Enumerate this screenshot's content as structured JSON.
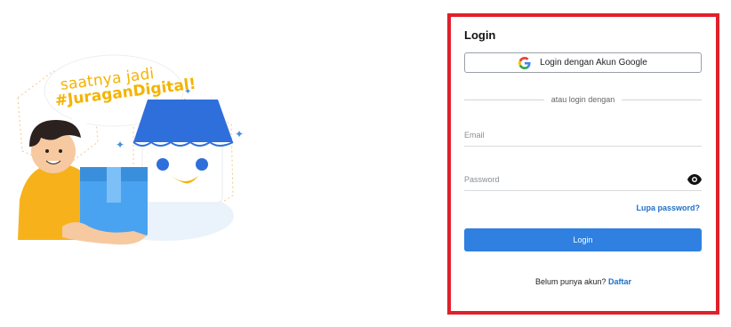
{
  "promo": {
    "line1": "saatnya jadi",
    "line2": "#JuraganDigital!"
  },
  "login": {
    "title": "Login",
    "google_button": "Login dengan Akun Google",
    "divider_text": "atau login dengan",
    "email_placeholder": "Email",
    "password_placeholder": "Password",
    "forgot_password": "Lupa password?",
    "submit_button": "Login",
    "signup_prompt": "Belum punya akun?",
    "signup_link": "Daftar"
  },
  "colors": {
    "accent": "#2f80e0",
    "highlight_border": "#e0202a",
    "promo_text": "#f5b301"
  },
  "icons": {
    "google": "google-icon",
    "password_toggle": "eye-icon"
  }
}
